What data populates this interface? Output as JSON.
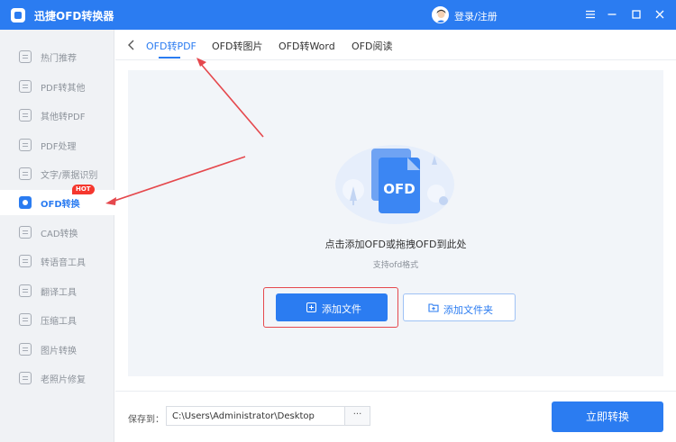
{
  "app": {
    "title": "迅捷OFD转换器",
    "login_label": "登录/注册"
  },
  "window_controls": [
    "menu-icon",
    "minimize-icon",
    "maximize-icon",
    "close-icon"
  ],
  "sidebar": {
    "items": [
      {
        "label": "热门推荐",
        "icon": "fire-icon",
        "active": false
      },
      {
        "label": "PDF转其他",
        "icon": "pdf-convert-icon",
        "active": false
      },
      {
        "label": "其他转PDF",
        "icon": "to-pdf-icon",
        "active": false
      },
      {
        "label": "PDF处理",
        "icon": "pdf-process-icon",
        "active": false
      },
      {
        "label": "文字/票据识别",
        "icon": "ocr-icon",
        "active": false
      },
      {
        "label": "OFD转换",
        "icon": "ofd-icon",
        "active": true,
        "badge": "HOT"
      },
      {
        "label": "CAD转换",
        "icon": "cad-icon",
        "active": false
      },
      {
        "label": "转语音工具",
        "icon": "voice-icon",
        "active": false
      },
      {
        "label": "翻译工具",
        "icon": "translate-icon",
        "active": false
      },
      {
        "label": "压缩工具",
        "icon": "compress-icon",
        "active": false
      },
      {
        "label": "图片转换",
        "icon": "image-icon",
        "active": false
      },
      {
        "label": "老照片修复",
        "icon": "photo-repair-icon",
        "active": false
      }
    ]
  },
  "tabs": [
    {
      "label": "OFD转PDF",
      "active": true
    },
    {
      "label": "OFD转图片",
      "active": false
    },
    {
      "label": "OFD转Word",
      "active": false
    },
    {
      "label": "OFD阅读",
      "active": false
    }
  ],
  "drop_area": {
    "illustration_text": "OFD",
    "title": "点击添加OFD或拖拽OFD到此处",
    "subtitle": "支持ofd格式",
    "add_file_label": "添加文件",
    "add_folder_label": "添加文件夹"
  },
  "footer": {
    "save_label": "保存到：",
    "save_path": "C:\\Users\\Administrator\\Desktop",
    "browse_label": "···",
    "convert_label": "立即转换"
  },
  "colors": {
    "accent": "#2b7cf1",
    "badge": "#f5372e",
    "annotation": "#e5484d"
  }
}
